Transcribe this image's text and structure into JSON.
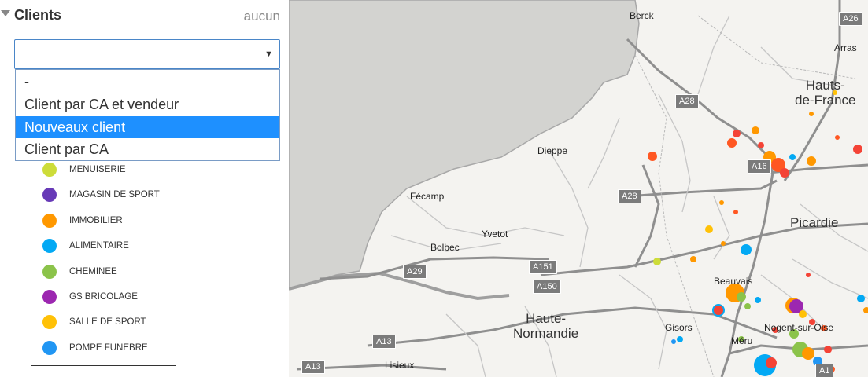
{
  "panel": {
    "title": "Clients",
    "reset_label": "aucun",
    "select": {
      "value": ""
    },
    "dropdown_options": [
      {
        "label": "-",
        "selected": false
      },
      {
        "label": "Client par CA et vendeur",
        "selected": false
      },
      {
        "label": "Nouveaux client",
        "selected": true
      },
      {
        "label": "Client par CA",
        "selected": false
      }
    ],
    "legend": [
      {
        "label": "MENUISERIE",
        "color": "#cddc39"
      },
      {
        "label": "MAGASIN DE SPORT",
        "color": "#673ab7"
      },
      {
        "label": "IMMOBILIER",
        "color": "#ff9800"
      },
      {
        "label": "ALIMENTAIRE",
        "color": "#03a9f4"
      },
      {
        "label": "CHEMINEE",
        "color": "#8bc34a"
      },
      {
        "label": "GS BRICOLAGE",
        "color": "#9c27b0"
      },
      {
        "label": "SALLE DE SPORT",
        "color": "#ffc107"
      },
      {
        "label": "POMPE FUNEBRE",
        "color": "#2196f3"
      }
    ]
  },
  "map": {
    "colors": {
      "sea": "#d3d3d0",
      "land": "#f4f3f0",
      "road": "#c9c9c9",
      "coast": "#aaaaaa"
    },
    "places": [
      "Berck",
      "Arras",
      "Dieppe",
      "Fécamp",
      "Yvetot",
      "Bolbec",
      "Lisieux",
      "Beauvais",
      "Gisors",
      "Méru",
      "Nogent-sur-Oise"
    ],
    "regions": {
      "hauts_de_france": "Hauts-\nde-France",
      "picardie": "Picardie",
      "haute_normandie": "Haute-\nNormandie"
    },
    "road_shields": [
      "A26",
      "A28",
      "A16",
      "A28",
      "A151",
      "A29",
      "A150",
      "A13",
      "A13",
      "A1"
    ],
    "client_marker_colors": [
      "#f44336",
      "#ff9800",
      "#ff5722",
      "#03a9f4",
      "#8bc34a",
      "#9c27b0",
      "#cddc39",
      "#ffc107",
      "#2196f3"
    ]
  }
}
